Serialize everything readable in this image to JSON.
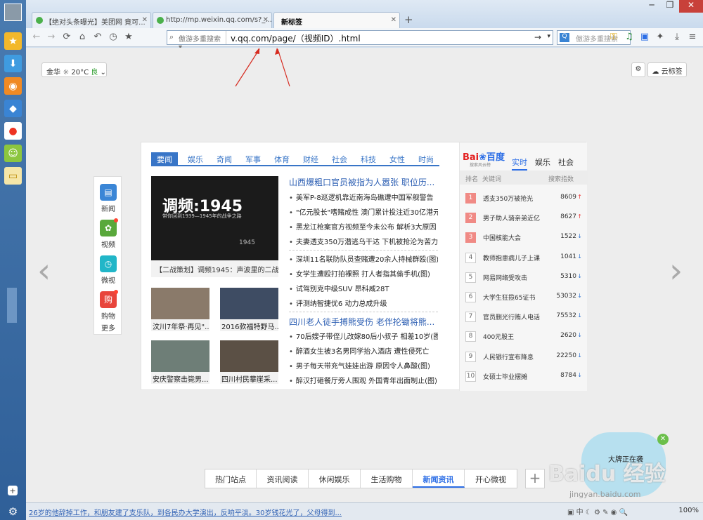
{
  "browser": {
    "tabs": [
      {
        "label": "【绝对头条曝光】美团网 竟可..."
      },
      {
        "label": "http://mp.weixin.qq.com/s?_..."
      },
      {
        "label": "新标签"
      }
    ],
    "address": {
      "search_source": "傲游多重搜索",
      "url": "v.qq.com/page/（视频ID）.html"
    },
    "search_placeholder": "傲游多重搜索",
    "zoom": "100%"
  },
  "page": {
    "weather": {
      "city": "金华",
      "temp": "20°C",
      "quality": "良"
    },
    "cloud_tab_label": "云标签",
    "left_nav": [
      {
        "label": "新闻",
        "icon": "news-icon",
        "color": "#3b86d6"
      },
      {
        "label": "视频",
        "icon": "video-icon",
        "color": "#59a83b"
      },
      {
        "label": "微视",
        "icon": "weishi-icon",
        "color": "#21b6c8"
      },
      {
        "label": "购物",
        "icon": "shopping-icon",
        "color": "#e8453c"
      },
      {
        "label": "更多"
      }
    ],
    "news_tabs": [
      "要闻",
      "娱乐",
      "奇闻",
      "军事",
      "体育",
      "财经",
      "社会",
      "科技",
      "女性",
      "时尚"
    ],
    "hero": {
      "title": "调频:1945",
      "subtitle": "带你回到1939—1945年的战争之路",
      "year": "1945",
      "caption": "【二战策划】调频1945：声波里的二战"
    },
    "thumbs": [
      {
        "caption": "汶川7年祭·再见\"..."
      },
      {
        "caption": "2016款福特野马..."
      },
      {
        "caption": "安庆警察击毙男..."
      },
      {
        "caption": "四川村民攀崖采..."
      }
    ],
    "headline1": "山西爆粗口官员被指为人嚣张 职位历...",
    "group1": [
      "美军P-8巡逻机靠近南海岛礁遭中国军舰警告",
      "\"亿元股长\"嗜赌成性 澳门累计投注近30亿港元",
      "黑龙江枪案官方视频至今未公布 解析3大原因",
      "夫妻透支350万潜逃乌干达 下机被抢沦为苦力"
    ],
    "group2": [
      "深圳11名联防队员查赌遭20余人持械群殴(图)",
      "女学生遭殴打拍裸照 打人者指其偷手机(图)",
      "试驾别克中级SUV 昂科威28T",
      "评测纳智捷优6 动力总成升级"
    ],
    "headline2": "四川老人徒手搏熊受伤 老伴抡锄将熊...",
    "group3": [
      "70后嫂子带侄儿改嫁80后小叔子 相差10岁(图)",
      "醉酒女生被3名男同学抬入酒店 遭性侵死亡",
      "男子每天带充气娃娃出游 原因令人鼻酸(图)",
      "醉汉打砸餐厅旁人围观 外国青年出面制止(图)"
    ],
    "baidu": {
      "logo_left": "Bai",
      "logo_right": "百度",
      "sub": "搜索风云榜",
      "tabs": [
        "实时",
        "娱乐",
        "社会"
      ],
      "col_rank": "排名",
      "col_keyword": "关键词",
      "col_index": "搜索指数"
    },
    "rankings": [
      {
        "n": "1",
        "t": "透支350万被抢光",
        "s": "8609",
        "trend": "↑"
      },
      {
        "n": "2",
        "t": "男子助人骑亲弟近亿",
        "s": "8627",
        "trend": "↑"
      },
      {
        "n": "3",
        "t": "中国核能大会",
        "s": "1522",
        "trend": "↓"
      },
      {
        "n": "4",
        "t": "教师抱患病儿子上课",
        "s": "1041",
        "trend": "↓"
      },
      {
        "n": "5",
        "t": "网易网络受攻击",
        "s": "5310",
        "trend": "↓"
      },
      {
        "n": "6",
        "t": "大学生狂揽65证书",
        "s": "53032",
        "trend": "↓"
      },
      {
        "n": "7",
        "t": "官员删光行贿人电话",
        "s": "75532",
        "trend": "↓"
      },
      {
        "n": "8",
        "t": "400元股王",
        "s": "2620",
        "trend": "↓"
      },
      {
        "n": "9",
        "t": "人民银行宣布降息",
        "s": "22250",
        "trend": "↓"
      },
      {
        "n": "10",
        "t": "女硕士毕业摆摊",
        "s": "8784",
        "trend": "↓"
      }
    ],
    "bottom_tabs": [
      "热门站点",
      "资讯阅读",
      "休闲娱乐",
      "生活购物",
      "新闻资讯",
      "开心微视"
    ],
    "bubble_text": "大牌正在袭"
  },
  "status": {
    "ticker": "26岁的他辞掉工作，和朋友建了支乐队，到各民办大学演出，反响平淡。30岁钱花光了，父母得到..."
  },
  "watermark": {
    "text": "Baidu 经验",
    "url": "jingyan.baidu.com"
  }
}
